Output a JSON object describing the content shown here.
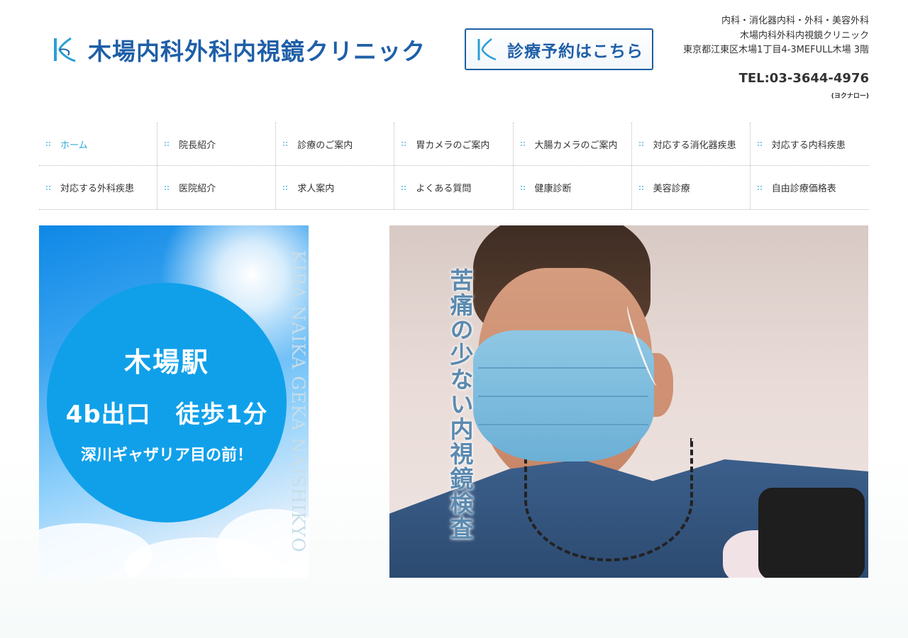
{
  "header": {
    "logo_text": "木場内科外科内視鏡クリニック",
    "reserve_label": "診療予約はこちら",
    "info_lines": [
      "内科・消化器内科・外科・美容外科",
      "木場内科外科内視鏡クリニック",
      "東京都江東区木場1丁目4-3MEFULL木場 3階"
    ],
    "tel": "TEL:03-3644-4976",
    "tel_sub": "(ヨクナロー)"
  },
  "nav": {
    "row1": [
      "ホーム",
      "院長紹介",
      "診療のご案内",
      "胃カメラのご案内",
      "大腸カメラのご案内",
      "対応する消化器疾患",
      "対応する内科疾患"
    ],
    "row2": [
      "対応する外科疾患",
      "医院紹介",
      "求人案内",
      "よくある質問",
      "健康診断",
      "美容診療",
      "自由診療価格表"
    ],
    "active": "ホーム"
  },
  "banner_left": {
    "line1": "木場駅",
    "line2": "4b出口　徒歩1分",
    "line3": "深川ギャザリア目の前！",
    "vertical_en": "KIBA NAIKA GEKA NAISHIKYO"
  },
  "banner_right": {
    "vertical_jp": "苦痛の少ない内視鏡検査"
  },
  "colors": {
    "brand_blue": "#1f5fa8",
    "nav_active": "#2fa7d9",
    "circle_blue": "#10a0ea"
  }
}
